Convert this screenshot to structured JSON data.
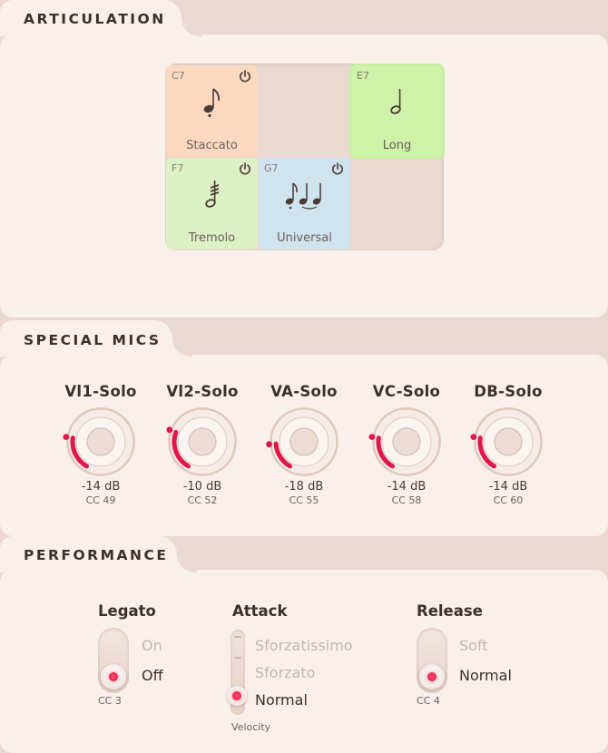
{
  "sections": {
    "articulation": "ARTICULATION",
    "special_mics": "SPECIAL MICS",
    "performance": "PERFORMANCE"
  },
  "articulations": [
    {
      "note": "C7",
      "label": "Staccato",
      "glyph": "♪",
      "color": "#fbd9c1",
      "active": false,
      "has_power": true
    },
    {
      "note": "E7",
      "label": "Long",
      "glyph": "𝅗𝅥",
      "color": "#cdf2a8",
      "active": true,
      "has_power": false
    },
    {
      "note": "F7",
      "label": "Tremolo",
      "glyph": "𝅘𝅥",
      "color": "#dcf1c6",
      "active": false,
      "has_power": true
    },
    {
      "note": "G7",
      "label": "Universal",
      "glyph": "♪♩♩",
      "color": "#cfe4ee",
      "active": false,
      "has_power": true
    }
  ],
  "mics": [
    {
      "name": "Vl1-Solo",
      "db": "-14 dB",
      "cc": "CC 49",
      "level_db": -14
    },
    {
      "name": "Vl2-Solo",
      "db": "-10 dB",
      "cc": "CC 52",
      "level_db": -10
    },
    {
      "name": "VA-Solo",
      "db": "-18 dB",
      "cc": "CC 55",
      "level_db": -18
    },
    {
      "name": "VC-Solo",
      "db": "-14 dB",
      "cc": "CC 58",
      "level_db": -14
    },
    {
      "name": "DB-Solo",
      "db": "-14 dB",
      "cc": "CC 60",
      "level_db": -14
    }
  ],
  "performance": {
    "legato": {
      "title": "Legato",
      "options": [
        "On",
        "Off"
      ],
      "selected": "Off",
      "cc": "CC 3"
    },
    "attack": {
      "title": "Attack",
      "options": [
        "Sforzatissimo",
        "Sforzato",
        "Normal"
      ],
      "selected": "Normal",
      "footer": "Velocity"
    },
    "release": {
      "title": "Release",
      "options": [
        "Soft",
        "Normal"
      ],
      "selected": "Normal",
      "cc": "CC 4"
    }
  },
  "colors": {
    "accent_red": "#e0184a",
    "panel": "#faf0eb",
    "background": "#ead9d2"
  }
}
